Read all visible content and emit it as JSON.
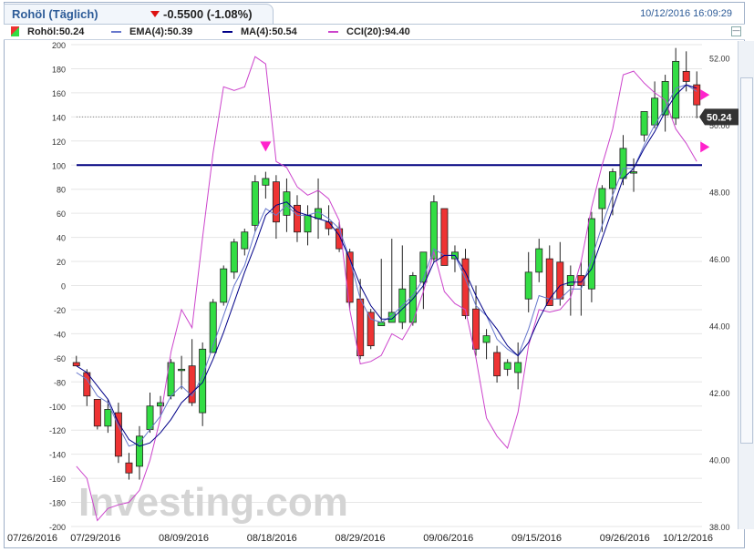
{
  "header": {
    "title": "Rohöl (Täglich)",
    "change": "-0.5500 (-1.08%)",
    "datetime": "10/12/2016 16:09:29"
  },
  "legend": {
    "price": "Rohöl:50.24",
    "ema": "EMA(4):50.39",
    "ma": "MA(4):50.54",
    "cci": "CCI(20):94.40"
  },
  "colors": {
    "up": "#33dd44",
    "down": "#ee3333",
    "ema": "#6677cc",
    "ma": "#000088",
    "cci": "#cc44cc",
    "threshold": "#000080",
    "marker": "#ff22cc",
    "title": "#2e5c98"
  },
  "watermark": "Investing.com",
  "price_tag": "50.24",
  "chart_data": {
    "type": "candlestick",
    "x_ticks": [
      "07/26/2016",
      "07/29/2016",
      "08/09/2016",
      "08/18/2016",
      "08/29/2016",
      "09/06/2016",
      "09/15/2016",
      "09/26/2016",
      "10/12/2016"
    ],
    "y_left_ticks": [
      "200",
      "180",
      "160",
      "140",
      "120",
      "100",
      "80",
      "60",
      "40",
      "20",
      "0",
      "-20",
      "-40",
      "-60",
      "-80",
      "-100",
      "-120",
      "-140",
      "-160",
      "-180",
      "-200"
    ],
    "y_right_ticks": [
      "52.00",
      "50.00",
      "48.00",
      "46.00",
      "44.00",
      "42.00",
      "40.00",
      "38.00"
    ],
    "price_range": [
      38,
      52.4
    ],
    "cci_range": [
      -200,
      200
    ],
    "cci_threshold": 100,
    "last_price": 50.24,
    "candles": [
      {
        "o": 42.9,
        "h": 43.1,
        "l": 42.8,
        "c": 42.8
      },
      {
        "o": 42.6,
        "h": 42.7,
        "l": 41.6,
        "c": 41.9
      },
      {
        "o": 41.8,
        "h": 41.8,
        "l": 40.9,
        "c": 41.0
      },
      {
        "o": 41.0,
        "h": 41.8,
        "l": 40.8,
        "c": 41.5
      },
      {
        "o": 41.4,
        "h": 41.7,
        "l": 39.9,
        "c": 40.1
      },
      {
        "o": 39.9,
        "h": 40.2,
        "l": 39.4,
        "c": 39.6
      },
      {
        "o": 39.8,
        "h": 41.0,
        "l": 39.4,
        "c": 40.7
      },
      {
        "o": 40.9,
        "h": 42.0,
        "l": 40.8,
        "c": 41.6
      },
      {
        "o": 41.6,
        "h": 41.9,
        "l": 41.3,
        "c": 41.7
      },
      {
        "o": 41.9,
        "h": 43.0,
        "l": 41.8,
        "c": 42.9
      },
      {
        "o": 42.7,
        "h": 43.1,
        "l": 42.1,
        "c": 42.7
      },
      {
        "o": 42.8,
        "h": 43.6,
        "l": 41.6,
        "c": 41.7
      },
      {
        "o": 41.4,
        "h": 43.5,
        "l": 41.0,
        "c": 43.3
      },
      {
        "o": 43.2,
        "h": 44.8,
        "l": 43.2,
        "c": 44.7
      },
      {
        "o": 44.7,
        "h": 45.8,
        "l": 44.6,
        "c": 45.7
      },
      {
        "o": 45.6,
        "h": 46.6,
        "l": 45.4,
        "c": 46.5
      },
      {
        "o": 46.3,
        "h": 46.9,
        "l": 46.1,
        "c": 46.8
      },
      {
        "o": 47.0,
        "h": 48.5,
        "l": 46.8,
        "c": 48.3
      },
      {
        "o": 48.2,
        "h": 48.6,
        "l": 47.8,
        "c": 48.4
      },
      {
        "o": 48.3,
        "h": 48.5,
        "l": 46.6,
        "c": 47.1
      },
      {
        "o": 47.3,
        "h": 48.4,
        "l": 46.8,
        "c": 48.0
      },
      {
        "o": 47.6,
        "h": 47.9,
        "l": 46.5,
        "c": 46.8
      },
      {
        "o": 46.8,
        "h": 47.6,
        "l": 46.4,
        "c": 47.3
      },
      {
        "o": 47.2,
        "h": 48.4,
        "l": 46.6,
        "c": 47.5
      },
      {
        "o": 47.1,
        "h": 47.6,
        "l": 46.7,
        "c": 46.9
      },
      {
        "o": 46.9,
        "h": 47.1,
        "l": 46.2,
        "c": 46.3
      },
      {
        "o": 46.2,
        "h": 46.3,
        "l": 44.5,
        "c": 44.7
      },
      {
        "o": 44.8,
        "h": 45.4,
        "l": 43.0,
        "c": 43.1
      },
      {
        "o": 44.4,
        "h": 44.5,
        "l": 43.3,
        "c": 43.4
      },
      {
        "o": 44.0,
        "h": 46.0,
        "l": 44.0,
        "c": 44.1
      },
      {
        "o": 44.1,
        "h": 46.6,
        "l": 44.1,
        "c": 44.4
      },
      {
        "o": 44.1,
        "h": 46.4,
        "l": 43.9,
        "c": 45.1
      },
      {
        "o": 44.1,
        "h": 45.6,
        "l": 44.0,
        "c": 45.5
      },
      {
        "o": 45.3,
        "h": 46.2,
        "l": 44.5,
        "c": 46.2
      },
      {
        "o": 46.0,
        "h": 47.9,
        "l": 45.9,
        "c": 47.7
      },
      {
        "o": 47.5,
        "h": 47.5,
        "l": 45.8,
        "c": 45.8
      },
      {
        "o": 46.0,
        "h": 46.4,
        "l": 45.6,
        "c": 46.2
      },
      {
        "o": 46.0,
        "h": 46.3,
        "l": 44.2,
        "c": 44.3
      },
      {
        "o": 44.5,
        "h": 45.2,
        "l": 43.1,
        "c": 43.3
      },
      {
        "o": 43.5,
        "h": 43.9,
        "l": 43.0,
        "c": 43.7
      },
      {
        "o": 43.2,
        "h": 43.4,
        "l": 42.3,
        "c": 42.5
      },
      {
        "o": 42.7,
        "h": 43.0,
        "l": 42.5,
        "c": 42.9
      },
      {
        "o": 42.6,
        "h": 43.5,
        "l": 42.1,
        "c": 42.9
      },
      {
        "o": 44.8,
        "h": 46.2,
        "l": 44.4,
        "c": 45.6
      },
      {
        "o": 45.6,
        "h": 46.6,
        "l": 45.3,
        "c": 46.3
      },
      {
        "o": 46.0,
        "h": 46.4,
        "l": 44.6,
        "c": 44.6
      },
      {
        "o": 45.9,
        "h": 46.5,
        "l": 44.6,
        "c": 44.8
      },
      {
        "o": 45.2,
        "h": 45.8,
        "l": 44.3,
        "c": 45.5
      },
      {
        "o": 45.5,
        "h": 45.9,
        "l": 44.3,
        "c": 45.2
      },
      {
        "o": 45.1,
        "h": 47.4,
        "l": 44.7,
        "c": 47.2
      },
      {
        "o": 47.5,
        "h": 48.2,
        "l": 46.8,
        "c": 48.1
      },
      {
        "o": 48.1,
        "h": 48.7,
        "l": 47.3,
        "c": 48.6
      },
      {
        "o": 48.4,
        "h": 49.7,
        "l": 48.2,
        "c": 49.3
      },
      {
        "o": 48.6,
        "h": 49.0,
        "l": 48.0,
        "c": 48.6
      },
      {
        "o": 49.7,
        "h": 50.4,
        "l": 49.5,
        "c": 50.4
      },
      {
        "o": 50.0,
        "h": 51.3,
        "l": 49.9,
        "c": 50.8
      },
      {
        "o": 50.3,
        "h": 51.5,
        "l": 49.8,
        "c": 51.3
      },
      {
        "o": 50.2,
        "h": 52.3,
        "l": 50.0,
        "c": 51.9
      },
      {
        "o": 51.6,
        "h": 52.2,
        "l": 51.0,
        "c": 51.3
      },
      {
        "o": 51.2,
        "h": 51.6,
        "l": 50.2,
        "c": 50.6
      }
    ],
    "ema": [
      42.6,
      42.4,
      41.9,
      41.7,
      41.0,
      40.4,
      40.5,
      40.9,
      41.3,
      41.9,
      42.2,
      41.9,
      42.5,
      43.4,
      44.3,
      45.2,
      45.8,
      46.8,
      47.5,
      47.3,
      47.6,
      47.3,
      47.3,
      47.4,
      47.2,
      46.9,
      46.0,
      44.8,
      44.2,
      44.1,
      44.3,
      44.6,
      44.9,
      45.4,
      46.3,
      46.1,
      46.1,
      45.4,
      44.6,
      44.3,
      43.6,
      43.3,
      43.1,
      43.9,
      44.9,
      44.8,
      44.8,
      45.1,
      45.1,
      46.0,
      47.0,
      47.9,
      48.7,
      48.7,
      49.4,
      50.0,
      50.5,
      51.1,
      51.2,
      51.0
    ],
    "ma": [
      42.8,
      42.6,
      42.2,
      41.8,
      41.1,
      40.6,
      40.4,
      40.5,
      40.8,
      41.2,
      41.7,
      42.0,
      42.3,
      43.0,
      43.8,
      44.7,
      45.6,
      46.4,
      47.3,
      47.6,
      47.7,
      47.4,
      47.3,
      47.2,
      47.1,
      46.7,
      46.0,
      45.2,
      44.6,
      44.2,
      44.2,
      44.5,
      44.8,
      45.2,
      45.9,
      46.1,
      46.1,
      45.6,
      44.9,
      44.3,
      43.9,
      43.4,
      43.1,
      43.5,
      44.2,
      44.8,
      45.2,
      45.3,
      45.3,
      45.7,
      46.6,
      47.5,
      48.4,
      48.7,
      49.3,
      49.8,
      50.4,
      50.9,
      51.2,
      51.1
    ],
    "cci": [
      -150,
      -160,
      -195,
      -185,
      -182,
      -180,
      -170,
      -145,
      -110,
      -55,
      -20,
      -35,
      40,
      110,
      165,
      162,
      165,
      190,
      184,
      103,
      98,
      82,
      75,
      79,
      72,
      54,
      -20,
      -65,
      -63,
      -58,
      -40,
      -45,
      -30,
      -5,
      28,
      -5,
      -15,
      -20,
      -60,
      -110,
      -125,
      -135,
      -105,
      -50,
      -20,
      -22,
      -20,
      -10,
      20,
      65,
      100,
      130,
      175,
      178,
      168,
      160,
      154,
      130,
      118,
      103
    ],
    "cci_markers": [
      {
        "index": 18,
        "cci": 115
      },
      {
        "index": 59,
        "cci": 115
      }
    ],
    "price_markers": [
      {
        "index": 59,
        "price": 50.9
      }
    ]
  }
}
